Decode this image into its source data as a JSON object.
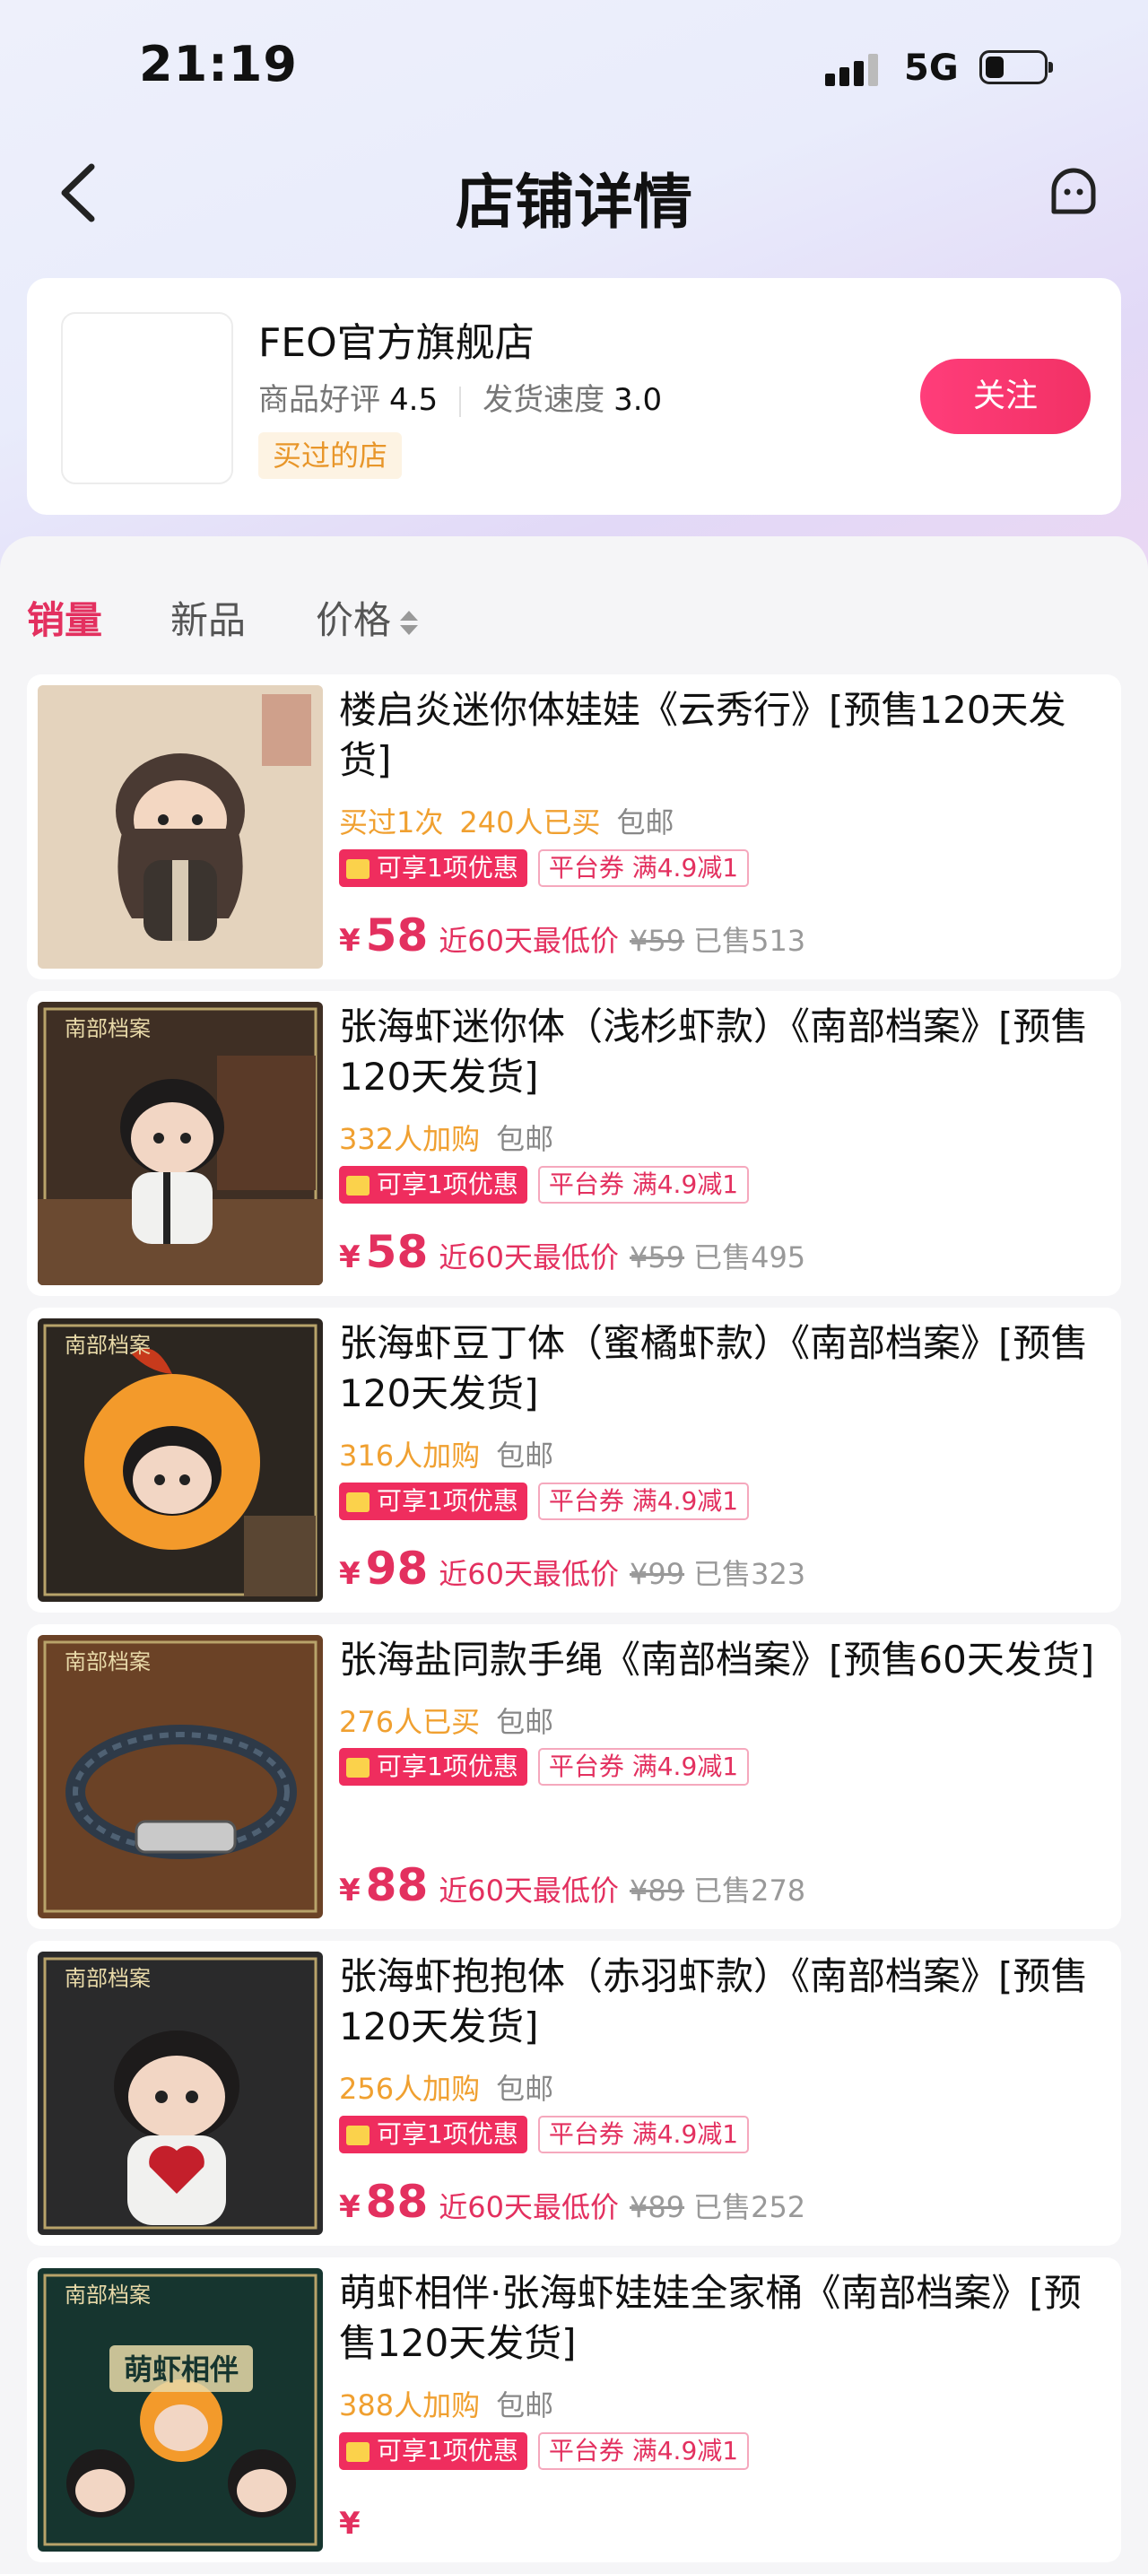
{
  "status_bar": {
    "time": "21:19",
    "network": "5G"
  },
  "nav": {
    "title": "店铺详情"
  },
  "shop": {
    "name": "FEO官方旗舰店",
    "rating_label": "商品好评",
    "rating_value": "4.5",
    "speed_label": "发货速度",
    "speed_value": "3.0",
    "tag": "买过的店",
    "follow_label": "关注"
  },
  "tabs": {
    "sales": "销量",
    "new": "新品",
    "price": "价格"
  },
  "products": [
    {
      "title": "楼启炎迷你体娃娃《云秀行》[预售120天发货]",
      "meta": [
        {
          "text": "买过1次",
          "tone": "orange"
        },
        {
          "text": "240人已买",
          "tone": "orange"
        },
        {
          "text": "包邮",
          "tone": "gray"
        }
      ],
      "coupon": "可享1项优惠",
      "platform_coupon": "平台券 满4.9减1",
      "currency": "¥",
      "price": "58",
      "price_note": "近60天最低价",
      "old_price": "¥59",
      "sold": "已售513",
      "image": "doll-long-hair"
    },
    {
      "title": "张海虾迷你体（浅杉虾款）《南部档案》[预售120天发货]",
      "meta": [
        {
          "text": "332人加购",
          "tone": "orange"
        },
        {
          "text": "包邮",
          "tone": "gray"
        }
      ],
      "coupon": "可享1项优惠",
      "platform_coupon": "平台券 满4.9减1",
      "currency": "¥",
      "price": "58",
      "price_note": "近60天最低价",
      "old_price": "¥59",
      "sold": "已售495",
      "image": "doll-white-shirt"
    },
    {
      "title": "张海虾豆丁体（蜜橘虾款）《南部档案》[预售120天发货]",
      "meta": [
        {
          "text": "316人加购",
          "tone": "orange"
        },
        {
          "text": "包邮",
          "tone": "gray"
        }
      ],
      "coupon": "可享1项优惠",
      "platform_coupon": "平台券 满4.9减1",
      "currency": "¥",
      "price": "98",
      "price_note": "近60天最低价",
      "old_price": "¥99",
      "sold": "已售323",
      "image": "doll-orange-costume"
    },
    {
      "title": "张海盐同款手绳《南部档案》[预售60天发货]",
      "meta": [
        {
          "text": "276人已买",
          "tone": "orange"
        },
        {
          "text": "包邮",
          "tone": "gray"
        }
      ],
      "coupon": "可享1项优惠",
      "platform_coupon": "平台券 满4.9减1",
      "currency": "¥",
      "price": "88",
      "price_note": "近60天最低价",
      "old_price": "¥89",
      "sold": "已售278",
      "image": "bracelet"
    },
    {
      "title": "张海虾抱抱体（赤羽虾款）《南部档案》[预售120天发货]",
      "meta": [
        {
          "text": "256人加购",
          "tone": "orange"
        },
        {
          "text": "包邮",
          "tone": "gray"
        }
      ],
      "coupon": "可享1项优惠",
      "platform_coupon": "平台券 满4.9减1",
      "currency": "¥",
      "price": "88",
      "price_note": "近60天最低价",
      "old_price": "¥89",
      "sold": "已售252",
      "image": "doll-red-heart"
    },
    {
      "title": "萌虾相伴·张海虾娃娃全家桶《南部档案》[预售120天发货]",
      "meta": [
        {
          "text": "388人加购",
          "tone": "orange"
        },
        {
          "text": "包邮",
          "tone": "gray"
        }
      ],
      "coupon": "可享1项优惠",
      "platform_coupon": "平台券 满4.9减1",
      "currency": "¥",
      "price": "",
      "price_note": "",
      "old_price": "",
      "sold": "",
      "image": "doll-family-set"
    }
  ],
  "image_text": {
    "series_logo": "南部档案",
    "family_banner": "萌虾相伴"
  },
  "colors": {
    "accent": "#e3305f",
    "orange": "#f0a030",
    "gray": "#888888",
    "follow_button": "#f23165"
  }
}
